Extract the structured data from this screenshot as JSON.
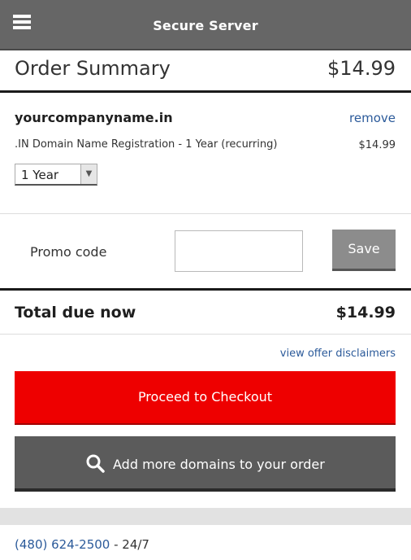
{
  "header": {
    "menu_icon": "hamburger-menu-icon",
    "title": "Secure Server"
  },
  "summary": {
    "title": "Order Summary",
    "total": "$14.99"
  },
  "item": {
    "domain": "yourcompanyname.in",
    "remove_label": "remove",
    "description": ".IN Domain Name Registration - 1 Year (recurring)",
    "price": "$14.99",
    "term_selected": "1 Year",
    "term_arrow_icon": "chevron-down-icon"
  },
  "promo": {
    "label": "Promo code",
    "value": "",
    "placeholder": "",
    "save_label": "Save"
  },
  "total": {
    "label": "Total due now",
    "amount": "$14.99"
  },
  "links": {
    "disclaimers": "view offer disclaimers"
  },
  "buttons": {
    "checkout_label": "Proceed to Checkout",
    "add_domains_label": "Add more domains to your order",
    "add_domains_icon": "search-icon"
  },
  "support": {
    "phone": "(480) 624-2500",
    "hours": " - 24/7"
  },
  "colors": {
    "header_bg": "#666666",
    "checkout_red": "#ee0000",
    "add_btn_gray": "#5b5b5b",
    "link_blue": "#2b5a9a"
  }
}
